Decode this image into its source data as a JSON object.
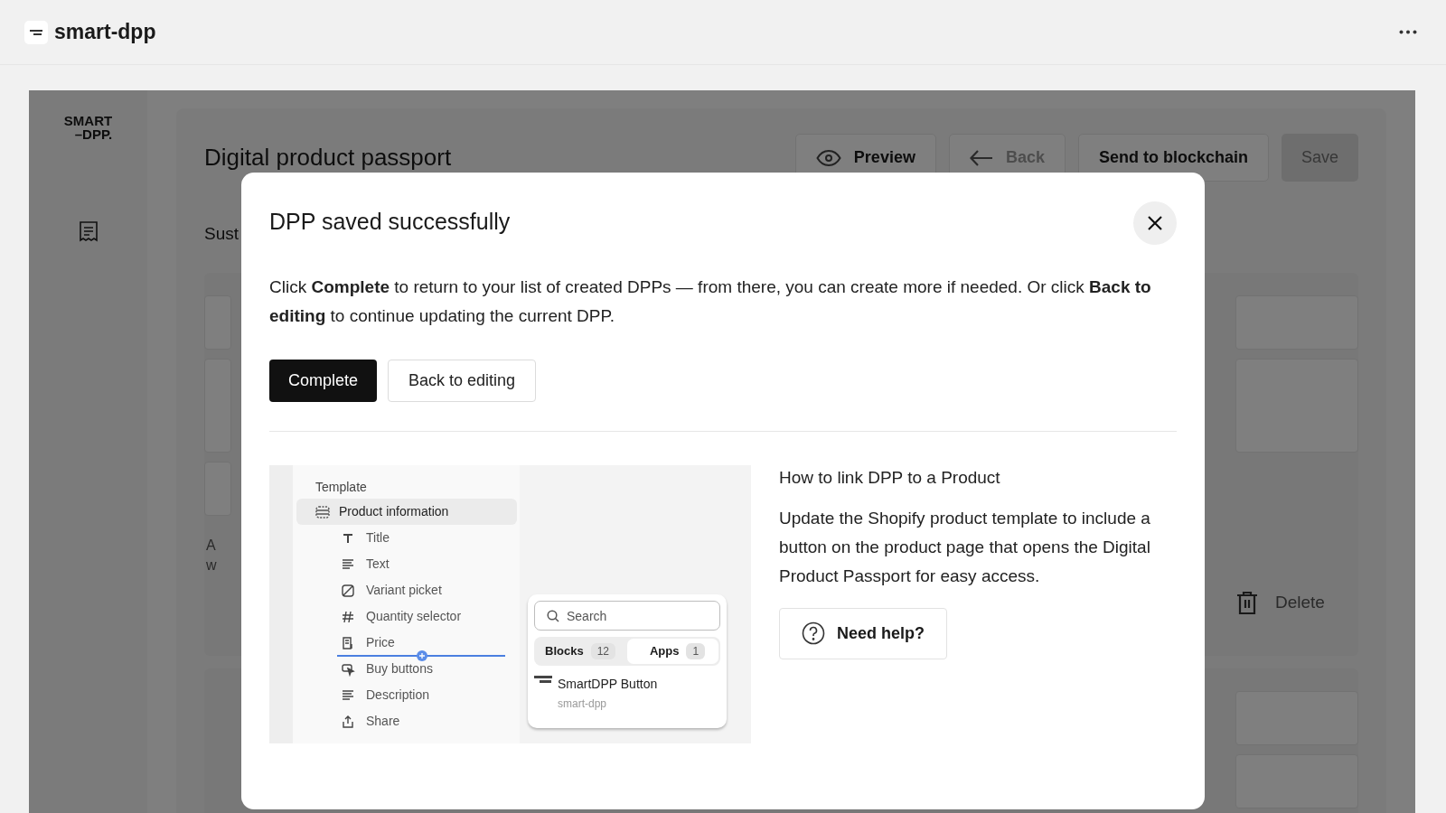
{
  "app_bar": {
    "title": "smart-dpp"
  },
  "page": {
    "logo": [
      "SMART",
      "–DPP."
    ],
    "title": "Digital product passport",
    "actions": [
      {
        "label": "Preview",
        "kind": "preview",
        "disabled": false
      },
      {
        "label": "Back",
        "kind": "back",
        "disabled": true
      },
      {
        "label": "Send to blockchain",
        "kind": "plain",
        "disabled": false
      },
      {
        "label": "Save",
        "kind": "primary",
        "disabled": true
      }
    ],
    "section_heading": "Sust",
    "fragments": [
      "A",
      "w"
    ],
    "delete_label": "Delete"
  },
  "dialog": {
    "title": "DPP saved successfully",
    "message": "Click **Complete** to return to your list of created DPPs — from there, you can create more if needed. Or click **Back to editing** to continue updating the current DPP.",
    "buttons": [
      {
        "label": "Complete",
        "kind": "primary"
      },
      {
        "label": "Back to editing",
        "kind": "secondary"
      }
    ],
    "illustration": {
      "section_label": "Template",
      "items": [
        {
          "label": "Product information",
          "selected": true,
          "children": [
            {
              "label": "Title",
              "selected": false
            },
            {
              "label": "Text",
              "selected": false
            },
            {
              "label": "Variant picket",
              "selected": false
            },
            {
              "label": "Quantity selector",
              "selected": false
            },
            {
              "label": "Price",
              "selected": false
            },
            {
              "label": "Buy buttons",
              "selected": false
            },
            {
              "label": "Description",
              "selected": false
            },
            {
              "label": "Share",
              "selected": false
            }
          ]
        }
      ],
      "search_placeholder": "Search",
      "tabs": [
        {
          "label": "Blocks",
          "count": "12",
          "selected": false
        },
        {
          "label": "Apps",
          "count": "1",
          "selected": true
        }
      ],
      "result": {
        "name": "SmartDPP Button",
        "subtitle": "smart-dpp"
      }
    },
    "help": {
      "heading": "How to link DPP to a Product",
      "body": "Update the Shopify product template to include a button on the product page that opens the Digital Product Passport for easy access.",
      "button": "Need help?"
    }
  }
}
